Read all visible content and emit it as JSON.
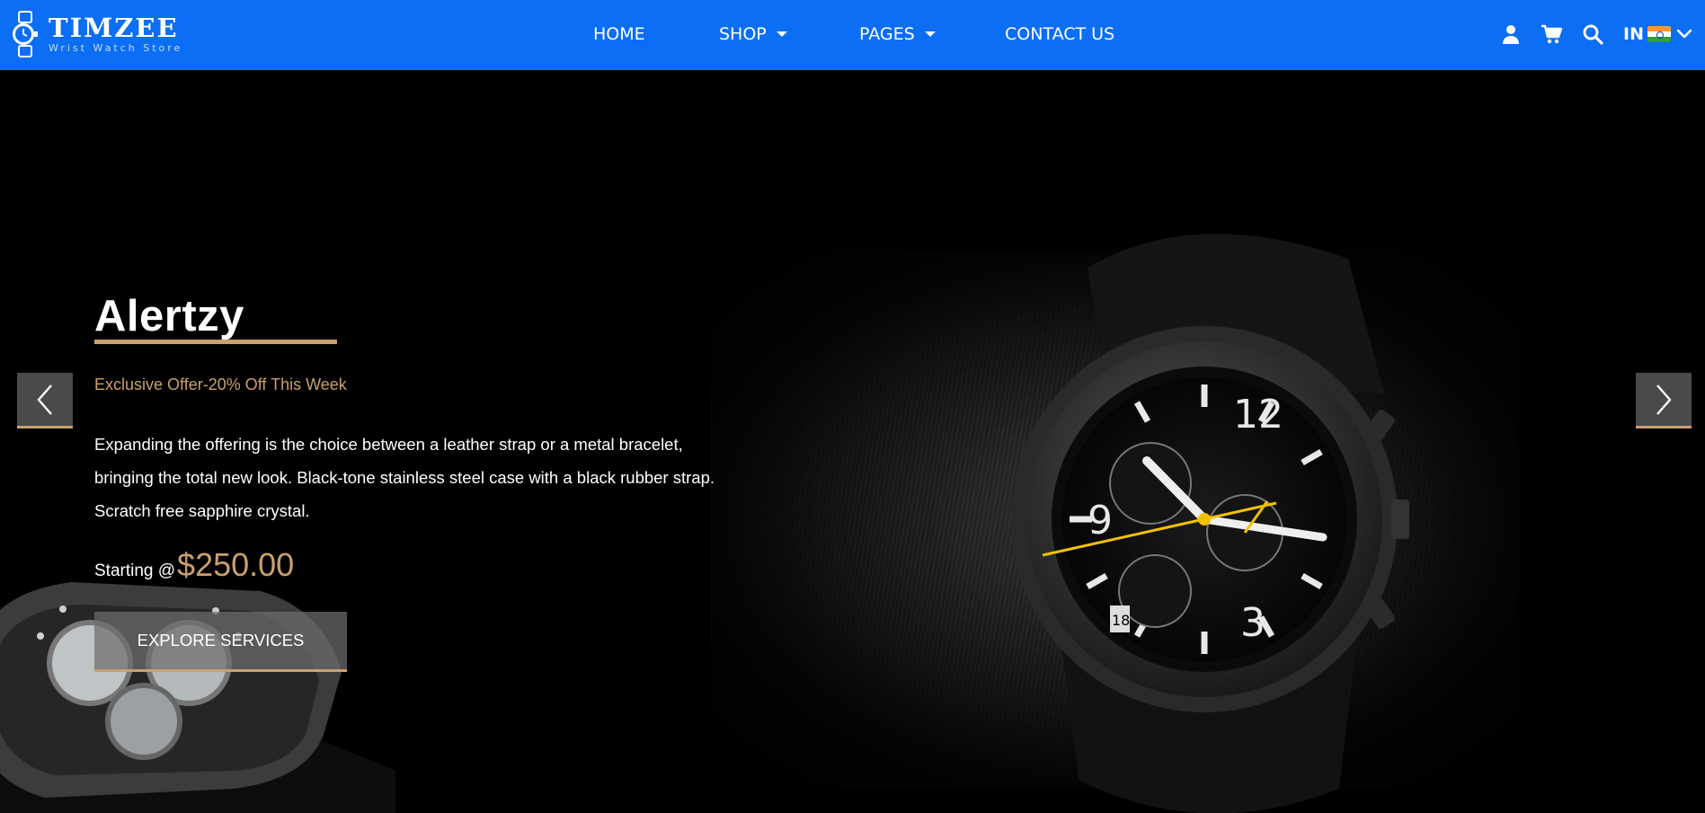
{
  "brand": {
    "name": "TIMZEE",
    "tagline": "Wrist Watch Store"
  },
  "nav": {
    "items": [
      {
        "label": "HOME",
        "has_dropdown": false
      },
      {
        "label": "SHOP",
        "has_dropdown": true
      },
      {
        "label": "PAGES",
        "has_dropdown": true
      },
      {
        "label": "CONTACT US",
        "has_dropdown": false
      }
    ]
  },
  "header_icons": [
    "user-icon",
    "cart-icon",
    "search-icon"
  ],
  "language": {
    "code": "IN",
    "flag": "india-flag-icon"
  },
  "hero": {
    "title": "Alertzy",
    "offer": "Exclusive Offer-20% Off This Week",
    "description_lines": [
      "Expanding the offering is the choice between a leather strap or a metal bracelet,",
      "bringing the total new look. Black-tone stainless steel case with a black rubber strap.",
      "Scratch free sapphire crystal."
    ],
    "price_label": "Starting @",
    "price": "$250.00",
    "cta_label": "EXPLORE SERVICES",
    "prev_icon": "chevron-left-icon",
    "next_icon": "chevron-right-icon"
  },
  "colors": {
    "header_bg": "#0b6ef5",
    "accent_gold": "#c9a06c",
    "hero_bg": "#000000",
    "arrow_bg": "#4a4a4a"
  }
}
